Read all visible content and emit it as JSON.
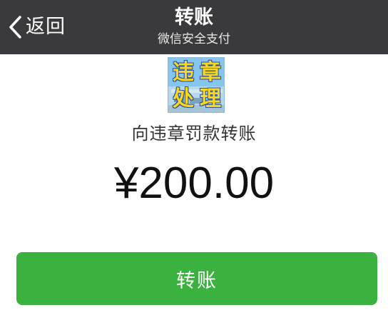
{
  "navbar": {
    "back_label": "返回",
    "title": "转账",
    "subtitle": "微信安全支付"
  },
  "payee": {
    "avatar_chars": [
      "违",
      "章",
      "处",
      "理"
    ],
    "caption": "向违章罚款转账"
  },
  "transfer": {
    "amount": "¥200.00",
    "button_label": "转账"
  },
  "colors": {
    "navbar_bg": "#3a3a3c",
    "button_green": "#3bb23f",
    "avatar_text": "#f8d81c"
  }
}
